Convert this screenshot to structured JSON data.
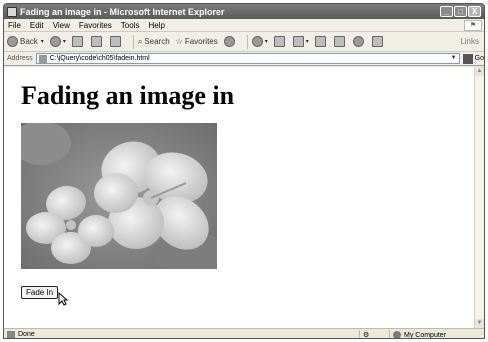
{
  "window": {
    "title": "Fading an image in - Microsoft Internet Explorer",
    "minimize": "_",
    "maximize": "□",
    "close": "X"
  },
  "menu": [
    "File",
    "Edit",
    "View",
    "Favorites",
    "Tools",
    "Help"
  ],
  "toolbar": {
    "back": "Back",
    "search": "Search",
    "favorites": "Favorites",
    "links": "Links"
  },
  "address": {
    "label": "Address",
    "url": "C:\\jQuery\\code\\ch05\\fadein.html",
    "go": "Go"
  },
  "page": {
    "heading": "Fading an image in",
    "image_alt": "hibiscus-flower",
    "button_label": "Fade In"
  },
  "status": {
    "text": "Done",
    "zone": "My Computer"
  }
}
